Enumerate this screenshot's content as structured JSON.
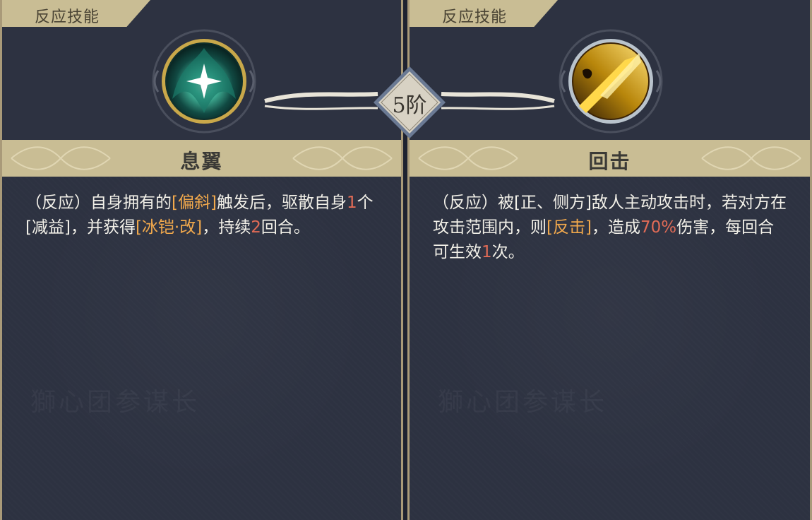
{
  "tier": "5阶",
  "left": {
    "tag": "反应技能",
    "icon": "teal-wing-star-icon",
    "name": "息翼",
    "desc": [
      {
        "t": "（反应）自身拥有的"
      },
      {
        "t": "[偏斜]",
        "c": "o"
      },
      {
        "t": "触发后，驱散自身"
      },
      {
        "t": "1",
        "c": "r"
      },
      {
        "t": "个[减益]，并获得"
      },
      {
        "t": "[冰铠·改]",
        "c": "o"
      },
      {
        "t": "，持续"
      },
      {
        "t": "2",
        "c": "r"
      },
      {
        "t": "回合。"
      }
    ],
    "watermark": "獅心团参谋长"
  },
  "right": {
    "tag": "反应技能",
    "icon": "golden-strike-icon",
    "name": "回击",
    "desc": [
      {
        "t": "（反应）被[正、侧方]敌人主动攻击时，若对方在攻击范围内，则"
      },
      {
        "t": "[反击]",
        "c": "o"
      },
      {
        "t": "，造成"
      },
      {
        "t": "70%",
        "c": "r"
      },
      {
        "t": "伤害，每回合可生效"
      },
      {
        "t": "1",
        "c": "r"
      },
      {
        "t": "次。"
      }
    ],
    "watermark": "獅心团参谋长"
  },
  "colors": {
    "panel_bg": "#2d3241",
    "gold": "#c9bd94",
    "highlight_orange": "#f2a94c",
    "highlight_red": "#e16b56",
    "text": "#f2f0e8"
  }
}
